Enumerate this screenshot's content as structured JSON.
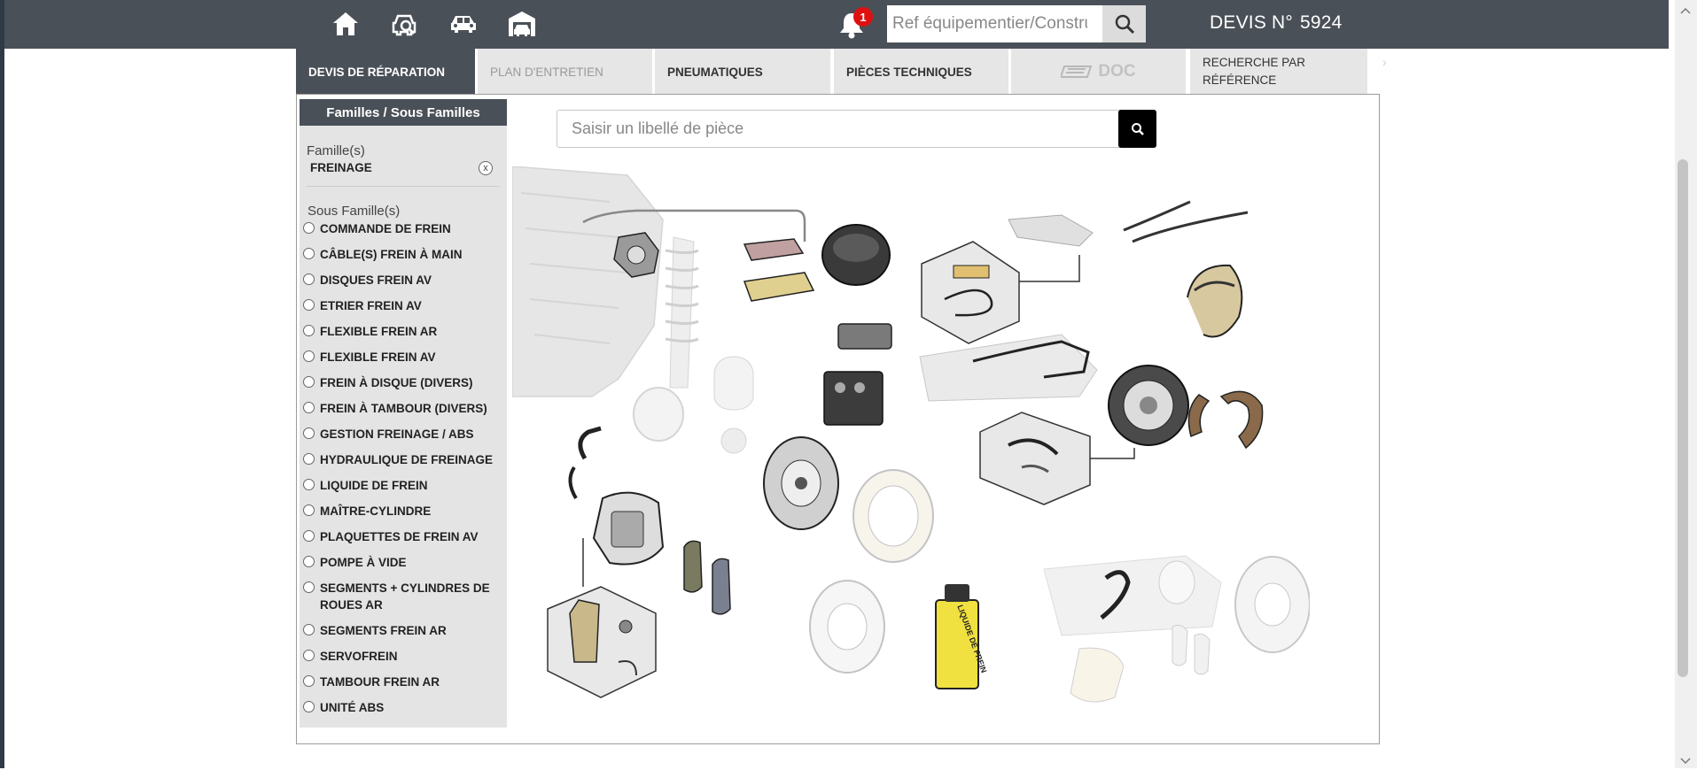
{
  "topbar": {
    "nav_icons": [
      "home-icon",
      "car-search-icon",
      "car-icon",
      "garage-icon"
    ],
    "notifications": {
      "count": "1"
    },
    "ref_search": {
      "placeholder": "Ref équipementier/Constructeur"
    },
    "devis": {
      "label": "DEVIS N°",
      "number": "5924"
    }
  },
  "tabs": [
    {
      "label": "DEVIS DE RÉPARATION",
      "state": "active"
    },
    {
      "label": "PLAN D'ENTRETIEN",
      "state": "disabled"
    },
    {
      "label": "PNEUMATIQUES",
      "state": "normal"
    },
    {
      "label": "PIÈCES TECHNIQUES",
      "state": "normal"
    },
    {
      "label": "DOC",
      "state": "disabled"
    },
    {
      "label": "RECHERCHE PAR RÉFÉRENCE",
      "state": "normal"
    }
  ],
  "sidebar": {
    "header": "Familles / Sous Familles",
    "famille_label": "Famille(s)",
    "famille_value": "FREINAGE",
    "famille_clear": "x",
    "sous_famille_label": "Sous Famille(s)",
    "sous_familles": [
      "COMMANDE DE FREIN",
      "CÂBLE(S) FREIN À MAIN",
      "DISQUES FREIN AV",
      "ETRIER FREIN AV",
      "FLEXIBLE FREIN AR",
      "FLEXIBLE FREIN AV",
      "FREIN À DISQUE (DIVERS)",
      "FREIN À TAMBOUR (DIVERS)",
      "GESTION FREINAGE / ABS",
      "HYDRAULIQUE DE FREINAGE",
      "LIQUIDE DE FREIN",
      "MAÎTRE-CYLINDRE",
      "PLAQUETTES DE FREIN AV",
      "POMPE À VIDE",
      "SEGMENTS + CYLINDRES DE ROUES AR",
      "SEGMENTS FREIN AR",
      "SERVOFREIN",
      "TAMBOUR FREIN AR",
      "UNITÉ ABS"
    ]
  },
  "main": {
    "piece_search": {
      "placeholder": "Saisir un libellé de pièce"
    },
    "illustration": {
      "bottle_label": "LIQUIDE DE FREIN"
    }
  },
  "colors": {
    "topbar": "#4a5058",
    "active_tab": "#4a5058",
    "tab_bg": "#e6e6e6",
    "sidebar_bg": "#e4e4e4",
    "badge": "#e01010"
  }
}
